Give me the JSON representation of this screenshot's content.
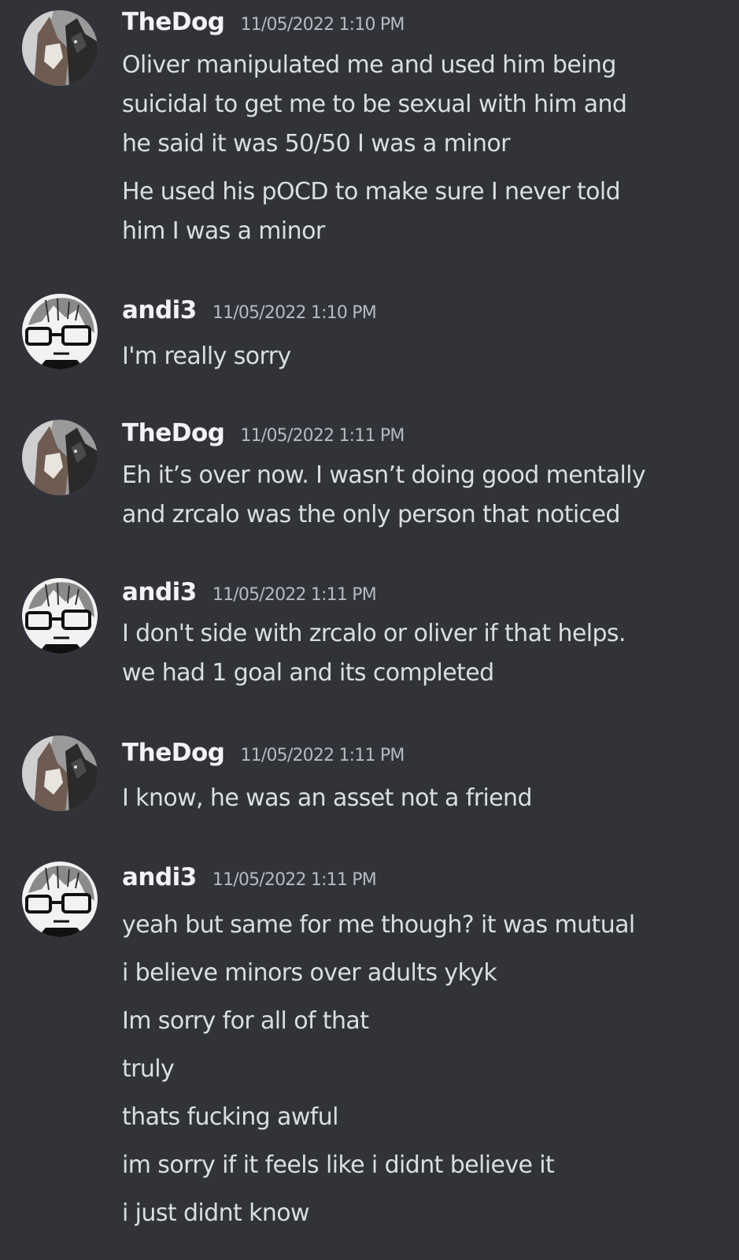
{
  "messages": [
    {
      "author": "TheDog",
      "timestamp": "11/05/2022 1:10 PM",
      "avatar_icon": "dog-avatar-icon",
      "lines": [
        "Oliver manipulated me and used him being",
        "suicidal to get me to be sexual with him and",
        "he said it was 50/50 I was a minor",
        "He used his pOCD to make sure I never told",
        "him I was a minor"
      ]
    },
    {
      "author": "andi3",
      "timestamp": "11/05/2022 1:10 PM",
      "avatar_icon": "glasses-character-avatar-icon",
      "lines": [
        "I'm really sorry"
      ]
    },
    {
      "author": "TheDog",
      "timestamp": "11/05/2022 1:11 PM",
      "avatar_icon": "dog-avatar-icon",
      "lines": [
        "Eh it’s over now. I wasn’t doing good mentally",
        "and zrcalo was the only person that noticed"
      ]
    },
    {
      "author": "andi3",
      "timestamp": "11/05/2022 1:11 PM",
      "avatar_icon": "glasses-character-avatar-icon",
      "lines": [
        "I don't side with zrcalo or oliver if that helps.",
        "we had 1 goal and its completed"
      ]
    },
    {
      "author": "TheDog",
      "timestamp": "11/05/2022 1:11 PM",
      "avatar_icon": "dog-avatar-icon",
      "lines": [
        "I know, he was an asset not a friend"
      ]
    },
    {
      "author": "andi3",
      "timestamp": "11/05/2022 1:11 PM",
      "avatar_icon": "glasses-character-avatar-icon",
      "lines": [
        "yeah but same for me though? it was mutual",
        "i believe minors over adults ykyk",
        "Im sorry for all of that",
        "truly",
        "thats fucking awful",
        "im sorry if it feels like i didnt believe it",
        "i just didnt know"
      ]
    }
  ],
  "colors": {
    "background": "#313338",
    "username": "#f2f3f5",
    "timestamp": "#b5bac1",
    "message_text": "#dbdee1"
  }
}
